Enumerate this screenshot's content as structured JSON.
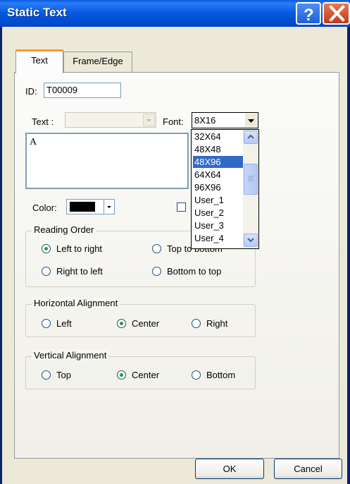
{
  "window": {
    "title": "Static Text"
  },
  "tabs": [
    {
      "label": "Text"
    },
    {
      "label": "Frame/Edge"
    }
  ],
  "id_field": {
    "label": "ID:",
    "value": "T00009"
  },
  "text_combo": {
    "label": "Text :"
  },
  "font_combo": {
    "label": "Font:",
    "value": "8X16"
  },
  "text_area": {
    "value": "A"
  },
  "color": {
    "label": "Color:",
    "value": "#000000"
  },
  "font_dropdown": {
    "items": [
      "32X64",
      "48X48",
      "48X96",
      "64X64",
      "96X96",
      "User_1",
      "User_2",
      "User_3",
      "User_4"
    ],
    "selected": "48X96"
  },
  "reading_order": {
    "title": "Reading Order",
    "options": [
      "Left to right",
      "Top to bottom",
      "Right to left",
      "Bottom to top"
    ],
    "selected": "Left to right"
  },
  "horizontal_alignment": {
    "title": "Horizontal Alignment",
    "options": [
      "Left",
      "Center",
      "Right"
    ],
    "selected": "Center"
  },
  "vertical_alignment": {
    "title": "Vertical Alignment",
    "options": [
      "Top",
      "Center",
      "Bottom"
    ],
    "selected": "Center"
  },
  "buttons": {
    "ok": "OK",
    "cancel": "Cancel"
  }
}
